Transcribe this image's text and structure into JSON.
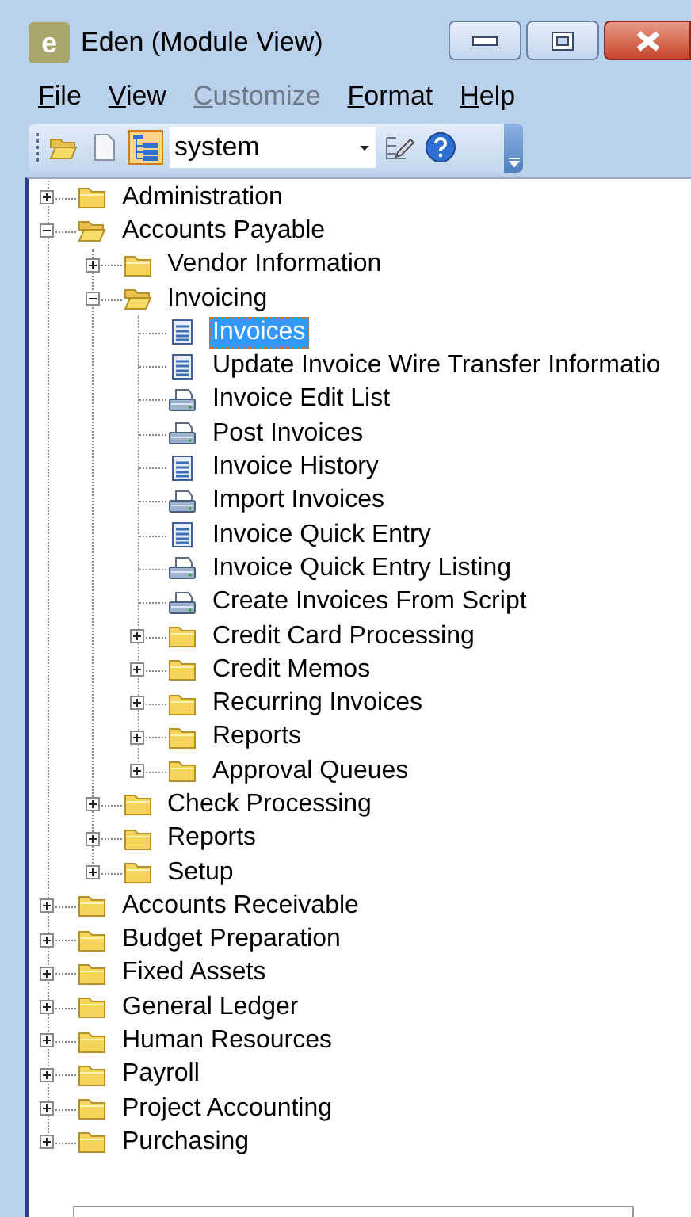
{
  "window": {
    "logo_letter": "e",
    "title": "Eden (Module View)"
  },
  "menu": [
    {
      "key": "F",
      "rest": "ile",
      "disabled": false
    },
    {
      "key": "V",
      "rest": "iew",
      "disabled": false
    },
    {
      "key": "C",
      "rest": "ustomize",
      "disabled": true
    },
    {
      "key": "F",
      "rest": "ormat",
      "disabled": false
    },
    {
      "key": "H",
      "rest": "elp",
      "disabled": false
    }
  ],
  "toolbar": {
    "tree_view_pressed": true,
    "combo_value": "system"
  },
  "tree": [
    {
      "label": "Administration",
      "kind": "folder",
      "expanded": false,
      "selected": false
    },
    {
      "label": "Accounts Payable",
      "kind": "folder",
      "expanded": true,
      "selected": false,
      "children": [
        {
          "label": "Vendor Information",
          "kind": "folder",
          "expanded": false,
          "selected": false
        },
        {
          "label": "Invoicing",
          "kind": "folder",
          "expanded": true,
          "selected": false,
          "children": [
            {
              "label": "Invoices",
              "kind": "form",
              "selected": true
            },
            {
              "label": "Update Invoice Wire Transfer Informatio",
              "kind": "form",
              "selected": false
            },
            {
              "label": "Invoice Edit List",
              "kind": "report",
              "selected": false
            },
            {
              "label": "Post Invoices",
              "kind": "report",
              "selected": false
            },
            {
              "label": "Invoice History",
              "kind": "form",
              "selected": false
            },
            {
              "label": "Import Invoices",
              "kind": "report",
              "selected": false
            },
            {
              "label": "Invoice Quick Entry",
              "kind": "form",
              "selected": false
            },
            {
              "label": "Invoice Quick Entry Listing",
              "kind": "report",
              "selected": false
            },
            {
              "label": "Create Invoices From Script",
              "kind": "report",
              "selected": false
            },
            {
              "label": "Credit Card Processing",
              "kind": "folder",
              "expanded": false,
              "selected": false
            },
            {
              "label": "Credit Memos",
              "kind": "folder",
              "expanded": false,
              "selected": false
            },
            {
              "label": "Recurring Invoices",
              "kind": "folder",
              "expanded": false,
              "selected": false
            },
            {
              "label": "Reports",
              "kind": "folder",
              "expanded": false,
              "selected": false
            },
            {
              "label": "Approval Queues",
              "kind": "folder",
              "expanded": false,
              "selected": false
            }
          ]
        },
        {
          "label": "Check Processing",
          "kind": "folder",
          "expanded": false,
          "selected": false
        },
        {
          "label": "Reports",
          "kind": "folder",
          "expanded": false,
          "selected": false
        },
        {
          "label": "Setup",
          "kind": "folder",
          "expanded": false,
          "selected": false
        }
      ]
    },
    {
      "label": "Accounts Receivable",
      "kind": "folder",
      "expanded": false,
      "selected": false
    },
    {
      "label": "Budget Preparation",
      "kind": "folder",
      "expanded": false,
      "selected": false
    },
    {
      "label": "Fixed Assets",
      "kind": "folder",
      "expanded": false,
      "selected": false
    },
    {
      "label": "General Ledger",
      "kind": "folder",
      "expanded": false,
      "selected": false
    },
    {
      "label": "Human Resources",
      "kind": "folder",
      "expanded": false,
      "selected": false
    },
    {
      "label": "Payroll",
      "kind": "folder",
      "expanded": false,
      "selected": false
    },
    {
      "label": "Project Accounting",
      "kind": "folder",
      "expanded": false,
      "selected": false
    },
    {
      "label": "Purchasing",
      "kind": "folder",
      "expanded": false,
      "selected": false
    }
  ]
}
